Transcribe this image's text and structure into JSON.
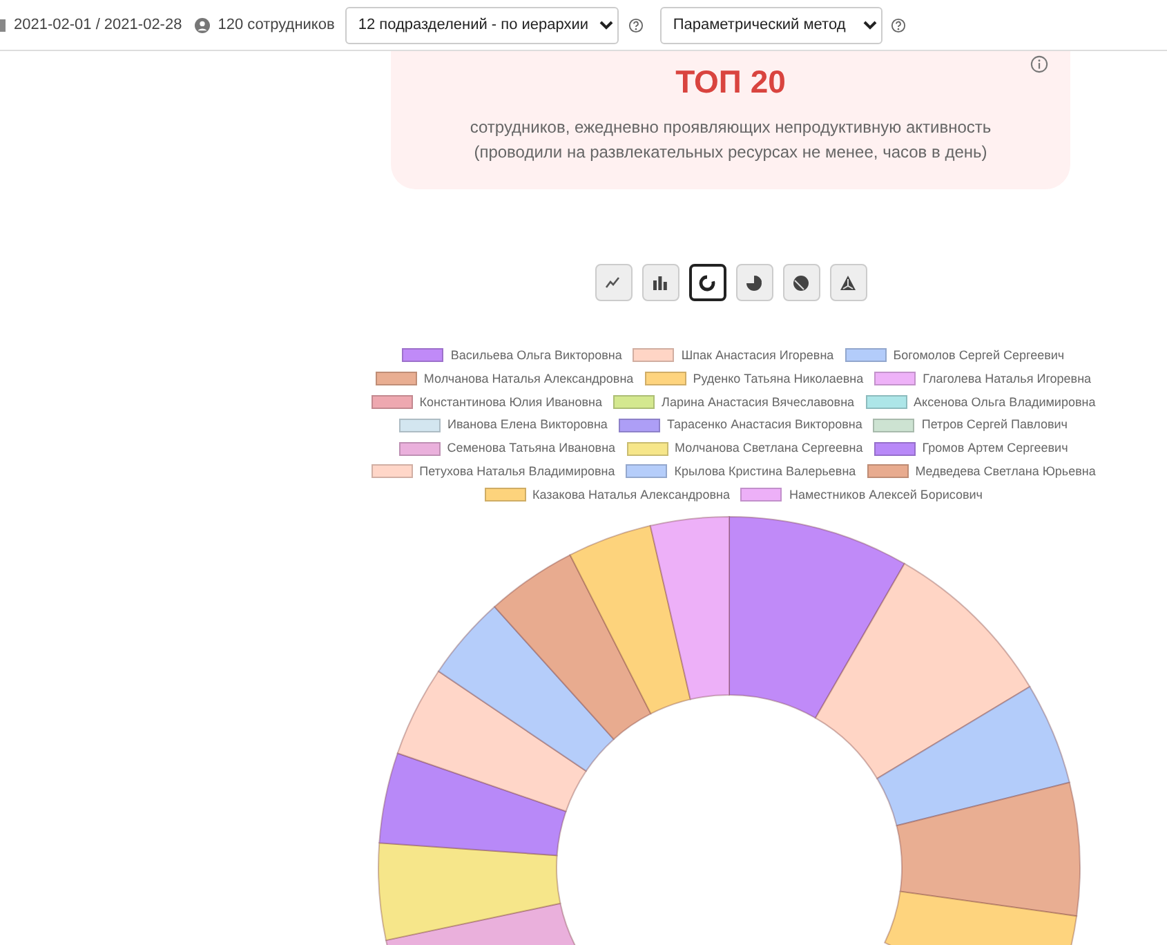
{
  "top_bar": {
    "period": "2021-02-01 / 2021-02-28",
    "employees": "120 сотрудников",
    "department_select": {
      "value": "12 подразделений - по иерархии"
    },
    "method_select": {
      "value": "Параметрический метод"
    }
  },
  "card": {
    "title": "ТОП 20",
    "subtitle": "сотрудников, ежедневно проявляющих непродуктивную активность",
    "note": "(проводили на развлекательных ресурсах не менее, часов в день)"
  },
  "chart_types": [
    {
      "kind": "line",
      "selected": false
    },
    {
      "kind": "bar",
      "selected": false
    },
    {
      "kind": "doughnut",
      "selected": true
    },
    {
      "kind": "pie",
      "selected": false
    },
    {
      "kind": "polar",
      "selected": false
    },
    {
      "kind": "radar",
      "selected": false
    }
  ],
  "legend": [
    {
      "label": "Васильева Ольга Викторовна",
      "color": "#c08af8"
    },
    {
      "label": "Шпак Анастасия Игоревна",
      "color": "#ffd5c5"
    },
    {
      "label": "Богомолов Сергей Сергеевич",
      "color": "#b3ccfa"
    },
    {
      "label": "Молчанова Наталья Александровна",
      "color": "#e9ae92"
    },
    {
      "label": "Руденко Татьяна Николаевна",
      "color": "#fed47e"
    },
    {
      "label": "Глаголева Наталья Игоревна",
      "color": "#eeb2f8"
    },
    {
      "label": "Константинова Юлия Ивановна",
      "color": "#eea8b0"
    },
    {
      "label": "Ларина Анастасия Вячеславовна",
      "color": "#d4e88f"
    },
    {
      "label": "Аксенова Ольга Владимировна",
      "color": "#ade6e8"
    },
    {
      "label": "Иванова Елена Викторовна",
      "color": "#d3e6f0"
    },
    {
      "label": "Тарасенко Анастасия Викторовна",
      "color": "#ad9ef6"
    },
    {
      "label": "Петров Сергей Павлович",
      "color": "#cde3d2"
    },
    {
      "label": "Семенова Татьяна Ивановна",
      "color": "#eab0dc"
    },
    {
      "label": "Молчанова Светлана Сергеевна",
      "color": "#f6e68a"
    },
    {
      "label": "Громов Артем Сергеевич",
      "color": "#b889f8"
    },
    {
      "label": "Петухова Наталья Владимировна",
      "color": "#ffd6c8"
    },
    {
      "label": "Крылова Кристина Валерьевна",
      "color": "#b5cdfa"
    },
    {
      "label": "Медведева Светлана Юрьевна",
      "color": "#e8ab8f"
    },
    {
      "label": "Казакова Наталья Александровна",
      "color": "#fdd37c"
    },
    {
      "label": "Наместников Алексей Борисович",
      "color": "#edb0f8"
    }
  ]
}
